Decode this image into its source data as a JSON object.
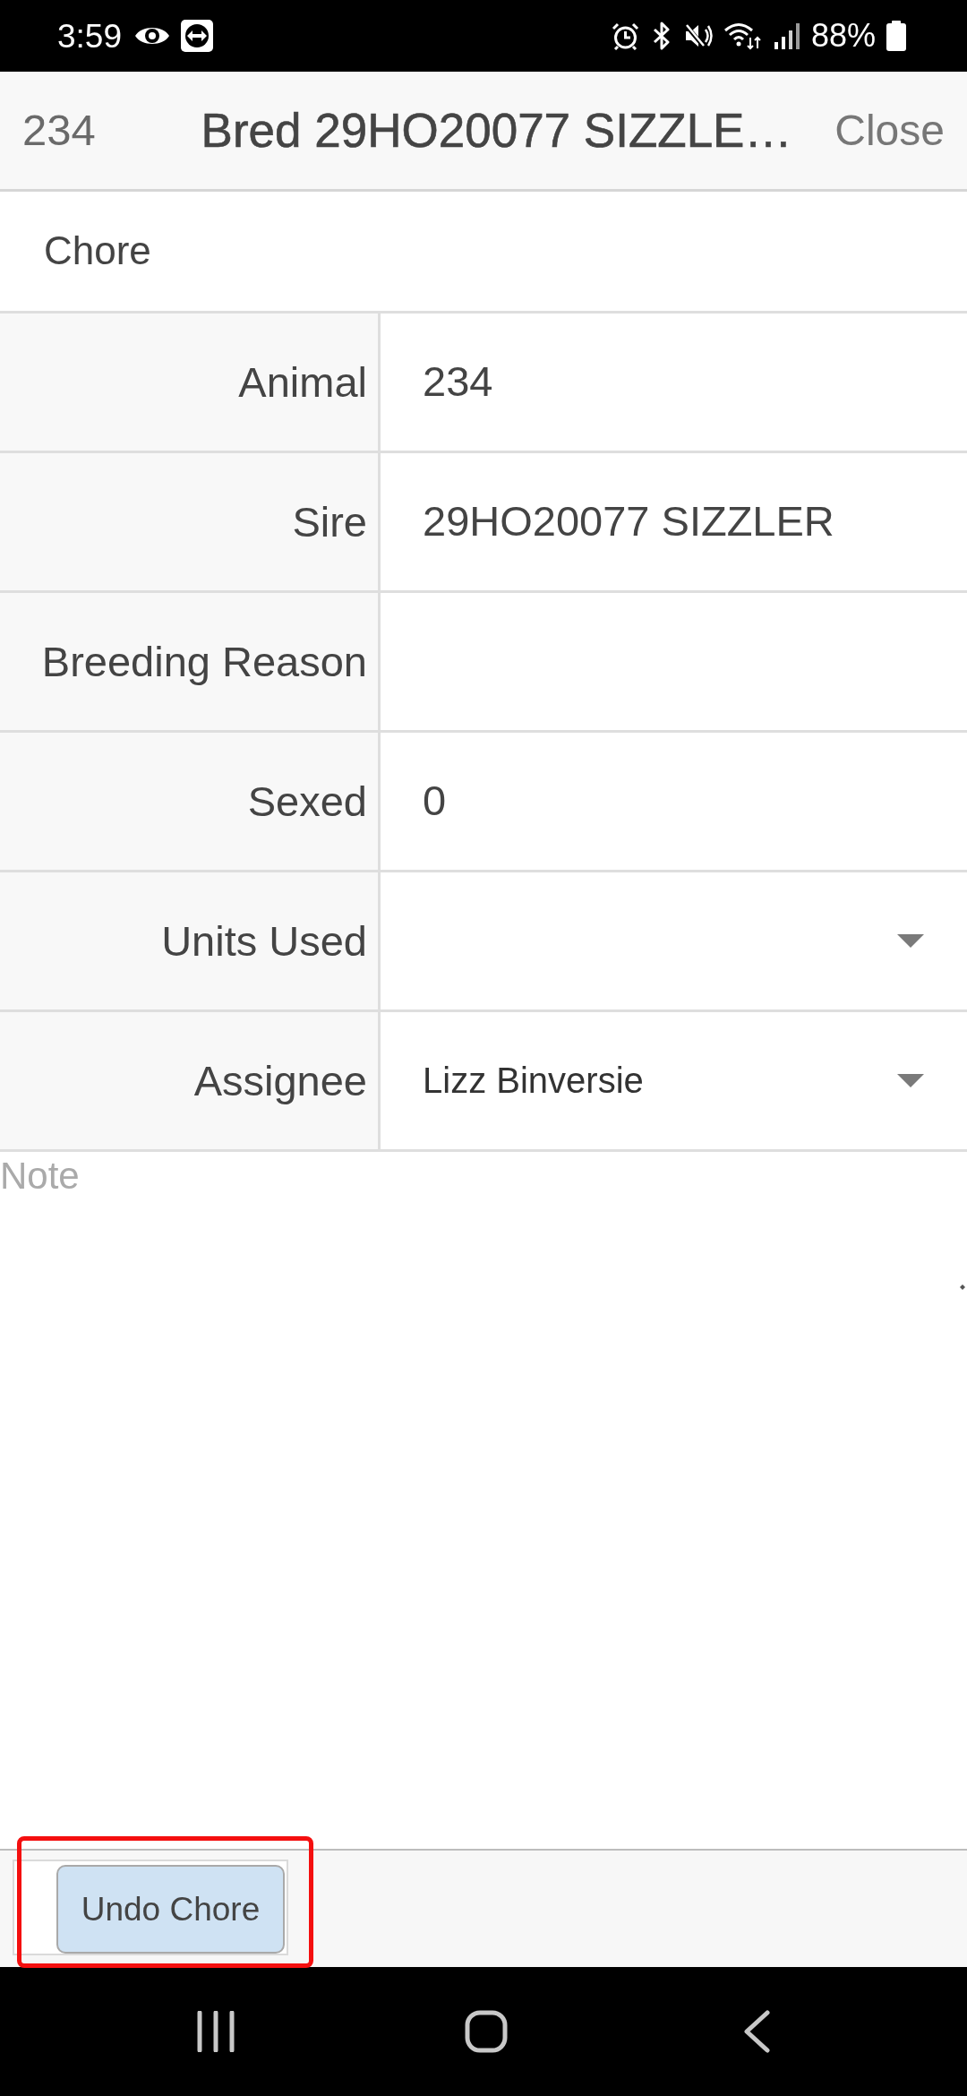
{
  "status_bar": {
    "time": "3:59",
    "battery": "88%"
  },
  "header": {
    "animal": "234",
    "title": "Bred 29HO20077 SIZZLE…",
    "close": "Close"
  },
  "section": {
    "title": "Chore"
  },
  "fields": [
    {
      "label": "Animal",
      "kind": "text",
      "value": "234"
    },
    {
      "label": "Sire",
      "kind": "text",
      "value": "29HO20077 SIZZLER"
    },
    {
      "label": "Breeding Reason",
      "kind": "text"
    },
    {
      "label": "Sexed",
      "kind": "text",
      "value": "0"
    },
    {
      "label": "Units Used",
      "kind": "select"
    },
    {
      "label": "Assignee",
      "kind": "select",
      "value": "Lizz Binversie"
    }
  ],
  "note": {
    "placeholder": "Note"
  },
  "footer": {
    "buttons": [
      "Undo Chore"
    ]
  }
}
